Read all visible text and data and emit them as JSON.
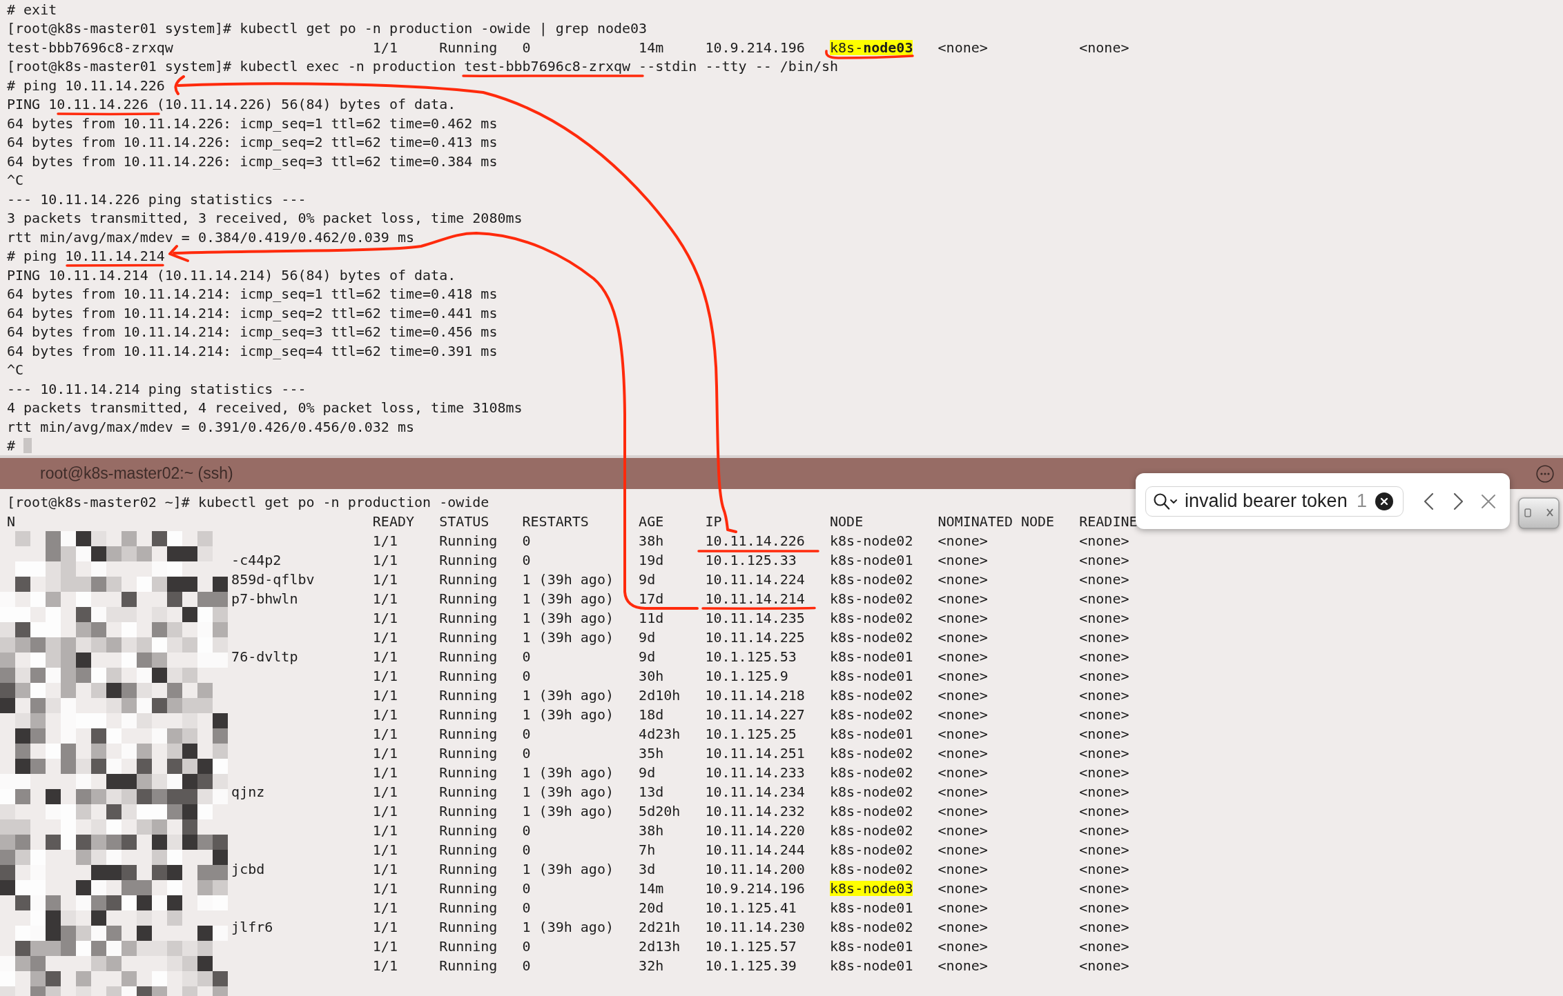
{
  "top_pane": {
    "lines": [
      {
        "kind": "text",
        "text": "# exit"
      },
      {
        "kind": "text",
        "text": "[root@k8s-master01 system]# kubectl get po -n production -owide | grep node03"
      },
      {
        "kind": "pod_row",
        "column_1": "test-bbb7696c8-zrxqw",
        "ready": "1/1",
        "status": "Running",
        "restarts": "0",
        "age": "14m",
        "ip": "10.9.214.196",
        "node": "k8s-**node03**",
        "node_highlighted": true,
        "nominated_node": "<none>",
        "column_9": "<none>"
      },
      {
        "kind": "text",
        "text": "[root@k8s-master01 system]# kubectl exec -n production test-bbb7696c8-zrxqw --stdin --tty -- /bin/sh"
      },
      {
        "kind": "text",
        "text": "# ping 10.11.14.226"
      },
      {
        "kind": "text",
        "text": "PING 10.11.14.226 (10.11.14.226) 56(84) bytes of data."
      },
      {
        "kind": "text",
        "text": "64 bytes from 10.11.14.226: icmp_seq=1 ttl=62 time=0.462 ms"
      },
      {
        "kind": "text",
        "text": "64 bytes from 10.11.14.226: icmp_seq=2 ttl=62 time=0.413 ms"
      },
      {
        "kind": "text",
        "text": "64 bytes from 10.11.14.226: icmp_seq=3 ttl=62 time=0.384 ms"
      },
      {
        "kind": "text",
        "text": "^C"
      },
      {
        "kind": "text",
        "text": "--- 10.11.14.226 ping statistics ---"
      },
      {
        "kind": "text",
        "text": "3 packets transmitted, 3 received, 0% packet loss, time 2080ms"
      },
      {
        "kind": "text",
        "text": "rtt min/avg/max/mdev = 0.384/0.419/0.462/0.039 ms"
      },
      {
        "kind": "text",
        "text": "# ping 10.11.14.214"
      },
      {
        "kind": "text",
        "text": "PING 10.11.14.214 (10.11.14.214) 56(84) bytes of data."
      },
      {
        "kind": "text",
        "text": "64 bytes from 10.11.14.214: icmp_seq=1 ttl=62 time=0.418 ms"
      },
      {
        "kind": "text",
        "text": "64 bytes from 10.11.14.214: icmp_seq=2 ttl=62 time=0.441 ms"
      },
      {
        "kind": "text",
        "text": "64 bytes from 10.11.14.214: icmp_seq=3 ttl=62 time=0.456 ms"
      },
      {
        "kind": "text",
        "text": "64 bytes from 10.11.14.214: icmp_seq=4 ttl=62 time=0.391 ms"
      },
      {
        "kind": "text",
        "text": "^C"
      },
      {
        "kind": "text",
        "text": "--- 10.11.14.214 ping statistics ---"
      },
      {
        "kind": "text",
        "text": "4 packets transmitted, 4 received, 0% packet loss, time 3108ms"
      },
      {
        "kind": "text",
        "text": "rtt min/avg/max/mdev = 0.391/0.426/0.456/0.032 ms"
      },
      {
        "kind": "prompt",
        "text": "#",
        "cursor": true
      }
    ]
  },
  "bottom_pane": {
    "title": "root@k8s-master02:~ (ssh)",
    "command": "[root@k8s-master02 ~]# kubectl get po -n production -owide",
    "columns": [
      "N",
      "READY",
      "STATUS",
      "RESTARTS",
      "AGE",
      "IP",
      "NODE",
      "NOMINATED NODE",
      "READINE"
    ],
    "rows": [
      {
        "ready": "1/1",
        "status": "Running",
        "restarts": "0",
        "age": "38h",
        "ip": "10.11.14.226",
        "node": "k8s-node02",
        "node_highlighted": false,
        "nominated_node": "<none>",
        "column_9": "<none>"
      },
      {
        "column_1": "-c44p2",
        "ready": "1/1",
        "status": "Running",
        "restarts": "0",
        "age": "19d",
        "ip": "10.1.125.33",
        "node": "k8s-node01",
        "node_highlighted": false,
        "nominated_node": "<none>",
        "column_9": "<none>"
      },
      {
        "column_1": "859d-qflbv",
        "ready": "1/1",
        "status": "Running",
        "restarts": "1 (39h ago)",
        "age": "9d",
        "ip": "10.11.14.224",
        "node": "k8s-node02",
        "node_highlighted": false,
        "nominated_node": "<none>",
        "column_9": "<none>"
      },
      {
        "column_1": "p7-bhwln",
        "ready": "1/1",
        "status": "Running",
        "restarts": "1 (39h ago)",
        "age": "17d",
        "ip": "10.11.14.214",
        "node": "k8s-node02",
        "node_highlighted": false,
        "nominated_node": "<none>",
        "column_9": "<none>"
      },
      {
        "ready": "1/1",
        "status": "Running",
        "restarts": "1 (39h ago)",
        "age": "11d",
        "ip": "10.11.14.235",
        "node": "k8s-node02",
        "node_highlighted": false,
        "nominated_node": "<none>",
        "column_9": "<none>"
      },
      {
        "ready": "1/1",
        "status": "Running",
        "restarts": "1 (39h ago)",
        "age": "9d",
        "ip": "10.11.14.225",
        "node": "k8s-node02",
        "node_highlighted": false,
        "nominated_node": "<none>",
        "column_9": "<none>"
      },
      {
        "column_1": "76-dvltp",
        "ready": "1/1",
        "status": "Running",
        "restarts": "0",
        "age": "9d",
        "ip": "10.1.125.53",
        "node": "k8s-node01",
        "node_highlighted": false,
        "nominated_node": "<none>",
        "column_9": "<none>"
      },
      {
        "ready": "1/1",
        "status": "Running",
        "restarts": "0",
        "age": "30h",
        "ip": "10.1.125.9",
        "node": "k8s-node01",
        "node_highlighted": false,
        "nominated_node": "<none>",
        "column_9": "<none>"
      },
      {
        "ready": "1/1",
        "status": "Running",
        "restarts": "1 (39h ago)",
        "age": "2d10h",
        "ip": "10.11.14.218",
        "node": "k8s-node02",
        "node_highlighted": false,
        "nominated_node": "<none>",
        "column_9": "<none>"
      },
      {
        "ready": "1/1",
        "status": "Running",
        "restarts": "1 (39h ago)",
        "age": "18d",
        "ip": "10.11.14.227",
        "node": "k8s-node02",
        "node_highlighted": false,
        "nominated_node": "<none>",
        "column_9": "<none>"
      },
      {
        "ready": "1/1",
        "status": "Running",
        "restarts": "0",
        "age": "4d23h",
        "ip": "10.1.125.25",
        "node": "k8s-node01",
        "node_highlighted": false,
        "nominated_node": "<none>",
        "column_9": "<none>"
      },
      {
        "ready": "1/1",
        "status": "Running",
        "restarts": "0",
        "age": "35h",
        "ip": "10.11.14.251",
        "node": "k8s-node02",
        "node_highlighted": false,
        "nominated_node": "<none>",
        "column_9": "<none>"
      },
      {
        "ready": "1/1",
        "status": "Running",
        "restarts": "1 (39h ago)",
        "age": "9d",
        "ip": "10.11.14.233",
        "node": "k8s-node02",
        "node_highlighted": false,
        "nominated_node": "<none>",
        "column_9": "<none>"
      },
      {
        "column_1": "qjnz",
        "ready": "1/1",
        "status": "Running",
        "restarts": "1 (39h ago)",
        "age": "13d",
        "ip": "10.11.14.234",
        "node": "k8s-node02",
        "node_highlighted": false,
        "nominated_node": "<none>",
        "column_9": "<none>"
      },
      {
        "ready": "1/1",
        "status": "Running",
        "restarts": "1 (39h ago)",
        "age": "5d20h",
        "ip": "10.11.14.232",
        "node": "k8s-node02",
        "node_highlighted": false,
        "nominated_node": "<none>",
        "column_9": "<none>"
      },
      {
        "ready": "1/1",
        "status": "Running",
        "restarts": "0",
        "age": "38h",
        "ip": "10.11.14.220",
        "node": "k8s-node02",
        "node_highlighted": false,
        "nominated_node": "<none>",
        "column_9": "<none>"
      },
      {
        "ready": "1/1",
        "status": "Running",
        "restarts": "0",
        "age": "7h",
        "ip": "10.11.14.244",
        "node": "k8s-node02",
        "node_highlighted": false,
        "nominated_node": "<none>",
        "column_9": "<none>"
      },
      {
        "column_1": "jcbd",
        "ready": "1/1",
        "status": "Running",
        "restarts": "1 (39h ago)",
        "age": "3d",
        "ip": "10.11.14.200",
        "node": "k8s-node02",
        "node_highlighted": false,
        "nominated_node": "<none>",
        "column_9": "<none>"
      },
      {
        "ready": "1/1",
        "status": "Running",
        "restarts": "0",
        "age": "14m",
        "ip": "10.9.214.196",
        "node": "k8s-node03",
        "node_highlighted": true,
        "nominated_node": "<none>",
        "column_9": "<none>"
      },
      {
        "ready": "1/1",
        "status": "Running",
        "restarts": "0",
        "age": "20d",
        "ip": "10.1.125.41",
        "node": "k8s-node01",
        "node_highlighted": false,
        "nominated_node": "<none>",
        "column_9": "<none>"
      },
      {
        "column_1": "jlfr6",
        "ready": "1/1",
        "status": "Running",
        "restarts": "1 (39h ago)",
        "age": "2d21h",
        "ip": "10.11.14.230",
        "node": "k8s-node02",
        "node_highlighted": false,
        "nominated_node": "<none>",
        "column_9": "<none>"
      },
      {
        "ready": "1/1",
        "status": "Running",
        "restarts": "0",
        "age": "2d13h",
        "ip": "10.1.125.57",
        "node": "k8s-node01",
        "node_highlighted": false,
        "nominated_node": "<none>",
        "column_9": "<none>"
      },
      {
        "ready": "1/1",
        "status": "Running",
        "restarts": "0",
        "age": "32h",
        "ip": "10.1.125.39",
        "node": "k8s-node01",
        "node_highlighted": false,
        "nominated_node": "<none>",
        "column_9": "<none>"
      }
    ]
  },
  "find_bar": {
    "value": "invalid bearer token",
    "match_count": "1"
  }
}
